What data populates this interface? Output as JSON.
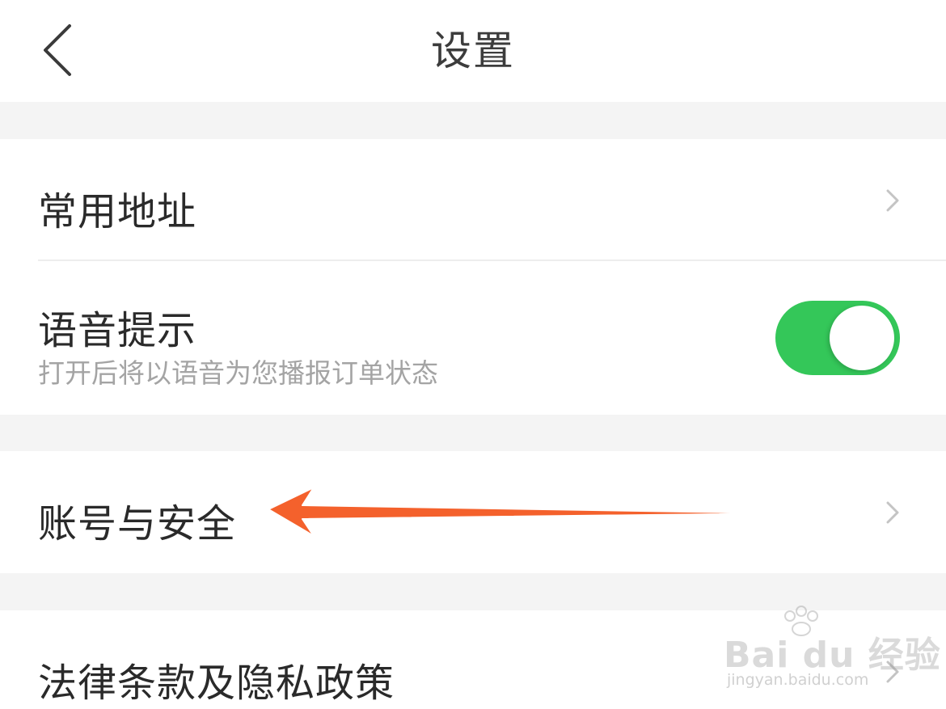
{
  "header": {
    "title": "设置"
  },
  "rows": {
    "address": {
      "label": "常用地址"
    },
    "voice": {
      "label": "语音提示",
      "description": "打开后将以语音为您播报订单状态",
      "toggle_on": true
    },
    "account": {
      "label": "账号与安全"
    },
    "legal": {
      "label": "法律条款及隐私政策"
    }
  },
  "colors": {
    "toggle_on": "#34c759",
    "annotation_arrow": "#f4612c",
    "section_gap": "#f4f4f4"
  },
  "icons": {
    "back": "back-chevron-icon",
    "row_arrow": "chevron-right-icon",
    "annotation": "annotation-arrow-icon"
  },
  "watermark": {
    "brand": "Bai du 经验",
    "site": "jingyan.baidu.com"
  }
}
